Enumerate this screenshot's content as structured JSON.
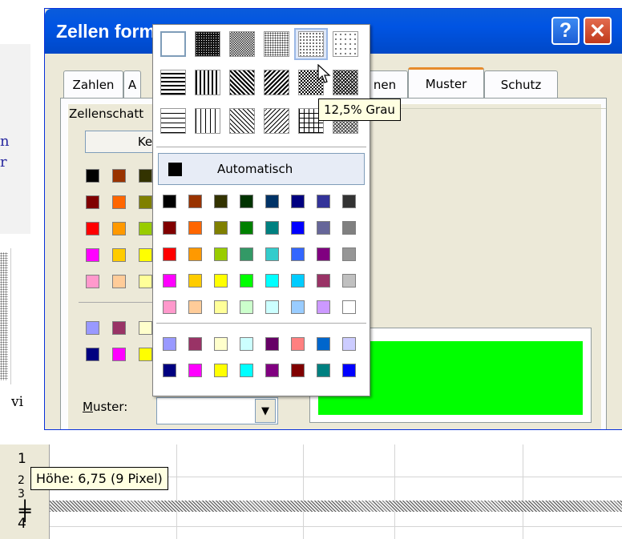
{
  "dialog": {
    "title": "Zellen formatieren",
    "help_glyph": "?",
    "close_glyph": "✕",
    "tabs": [
      {
        "label": "Zahlen"
      },
      {
        "label": "A"
      },
      {
        "label": "nen"
      },
      {
        "label": "Muster"
      },
      {
        "label": "Schutz"
      }
    ],
    "shading_label": "Zellenschatt",
    "no_color_button": "Ke",
    "pattern_label": "Muster:",
    "pattern_label_mnemonic": "M",
    "combo_arrow": "▼",
    "preview_color": "#00ff00"
  },
  "palette": {
    "selected_pattern_tooltip": "12,5% Grau",
    "automatic_label": "Automatisch",
    "colors_standard": [
      [
        "#000000",
        "#993300",
        "#333300",
        "#003300",
        "#003366",
        "#000080",
        "#333399",
        "#333333"
      ],
      [
        "#800000",
        "#ff6600",
        "#808000",
        "#008000",
        "#008080",
        "#0000ff",
        "#666699",
        "#808080"
      ],
      [
        "#ff0000",
        "#ff9900",
        "#99cc00",
        "#339966",
        "#33cccc",
        "#3366ff",
        "#800080",
        "#969696"
      ],
      [
        "#ff00ff",
        "#ffcc00",
        "#ffff00",
        "#00ff00",
        "#00ffff",
        "#00ccff",
        "#993366",
        "#c0c0c0"
      ],
      [
        "#ff99cc",
        "#ffcc99",
        "#ffff99",
        "#ccffcc",
        "#ccffff",
        "#99ccff",
        "#cc99ff",
        "#ffffff"
      ]
    ],
    "colors_chart": [
      [
        "#9999ff",
        "#993366",
        "#ffffcc",
        "#ccffff",
        "#660066",
        "#ff8080",
        "#0066cc",
        "#ccccff"
      ],
      [
        "#000080",
        "#ff00ff",
        "#ffff00",
        "#00ffff",
        "#800080",
        "#800000",
        "#008080",
        "#0000ff"
      ]
    ]
  },
  "left_swatches": [
    [
      "#000000",
      "#993300",
      "#333300"
    ],
    [
      "#800000",
      "#ff6600",
      "#808000"
    ],
    [
      "#ff0000",
      "#ff9900",
      "#99cc00"
    ],
    [
      "#ff00ff",
      "#ffcc00",
      "#ffff00"
    ],
    [
      "#ff99cc",
      "#ffcc99",
      "#ffff99"
    ],
    [
      "#9999ff",
      "#993366",
      "#ffffcc"
    ],
    [
      "#000080",
      "#ff00ff",
      "#ffff00"
    ]
  ],
  "doc": {
    "line1": "n",
    "line2": "r",
    "fragment": "vi"
  },
  "sheet": {
    "rows": [
      "1",
      "2",
      "3",
      "4"
    ],
    "height_tooltip": "Höhe: 6,75 (9 Pixel)",
    "resize_cursor": "╪"
  }
}
